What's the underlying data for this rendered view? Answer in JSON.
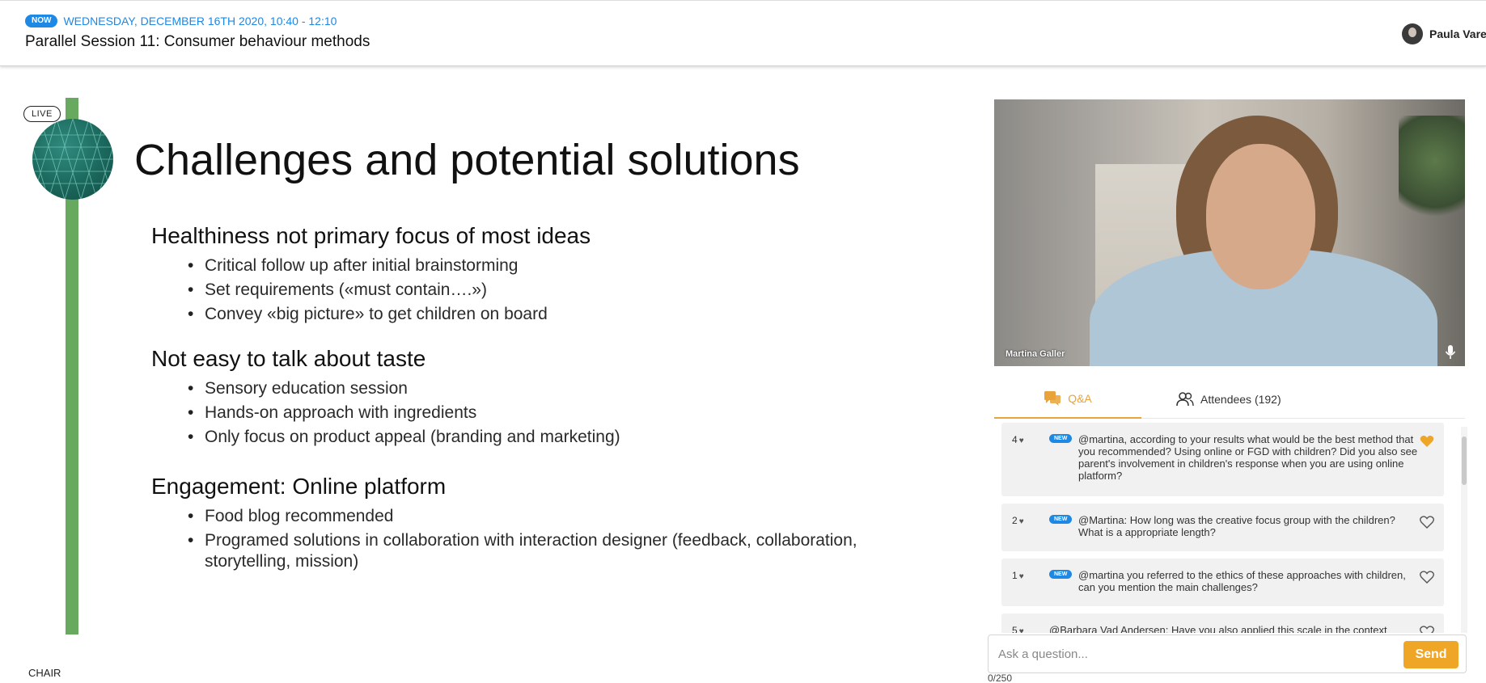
{
  "header": {
    "now_badge": "NOW",
    "session_date": "WEDNESDAY, DECEMBER 16TH 2020, 10:40 - 12:10",
    "session_title": "Parallel Session 11: Consumer behaviour methods",
    "user_name": "Paula Varel"
  },
  "slide": {
    "live_badge": "LIVE",
    "title": "Challenges and potential solutions",
    "sections": [
      {
        "heading": "Healthiness not primary focus of most ideas",
        "bullets": [
          "Critical follow up after initial brainstorming",
          "Set requirements («must contain….»)",
          "Convey «big picture» to get children on board"
        ]
      },
      {
        "heading": "Not easy to talk about taste",
        "bullets": [
          "Sensory education session",
          "Hands-on approach with ingredients",
          "Only focus on product appeal (branding and marketing)"
        ]
      },
      {
        "heading": "Engagement: Online platform",
        "bullets": [
          "Food blog recommended",
          "Programed solutions in collaboration with interaction designer (feedback, collaboration,",
          "storytelling, mission)"
        ]
      }
    ]
  },
  "chair_label": "CHAIR",
  "video": {
    "speaker_name": "Martina Galler"
  },
  "tabs": {
    "qa": "Q&A",
    "attendees": "Attendees (192)"
  },
  "questions": [
    {
      "votes": "4",
      "badge": "NEW",
      "text": "@martina, according to your results what would be the best method that you recommended? Using online or FGD with children? Did you also see parent's involvement in children's response when you are using online platform?",
      "liked": true
    },
    {
      "votes": "2",
      "badge": "NEW",
      "text": "@Martina: How long was the creative focus group with the children? What is a appropriate length?",
      "liked": false
    },
    {
      "votes": "1",
      "badge": "NEW",
      "text": "@martina you referred to the ethics of these approaches with children, can you mention the main challenges?",
      "liked": false
    },
    {
      "votes": "5",
      "badge": "",
      "text": "@Barbara Vad Andersen: Have you also applied this scale in the context",
      "liked": false
    }
  ],
  "ask": {
    "placeholder": "Ask a question...",
    "send_label": "Send",
    "counter": "0/250"
  },
  "colors": {
    "accent_blue": "#1e88e5",
    "accent_orange": "#efa526",
    "slide_green": "#67aa5f"
  },
  "icons": {
    "qa_tab": "chat-bubbles-icon",
    "attendees_tab": "people-icon",
    "mic": "microphone-icon",
    "vote": "heart-icon",
    "like": "heart-outline-icon"
  }
}
